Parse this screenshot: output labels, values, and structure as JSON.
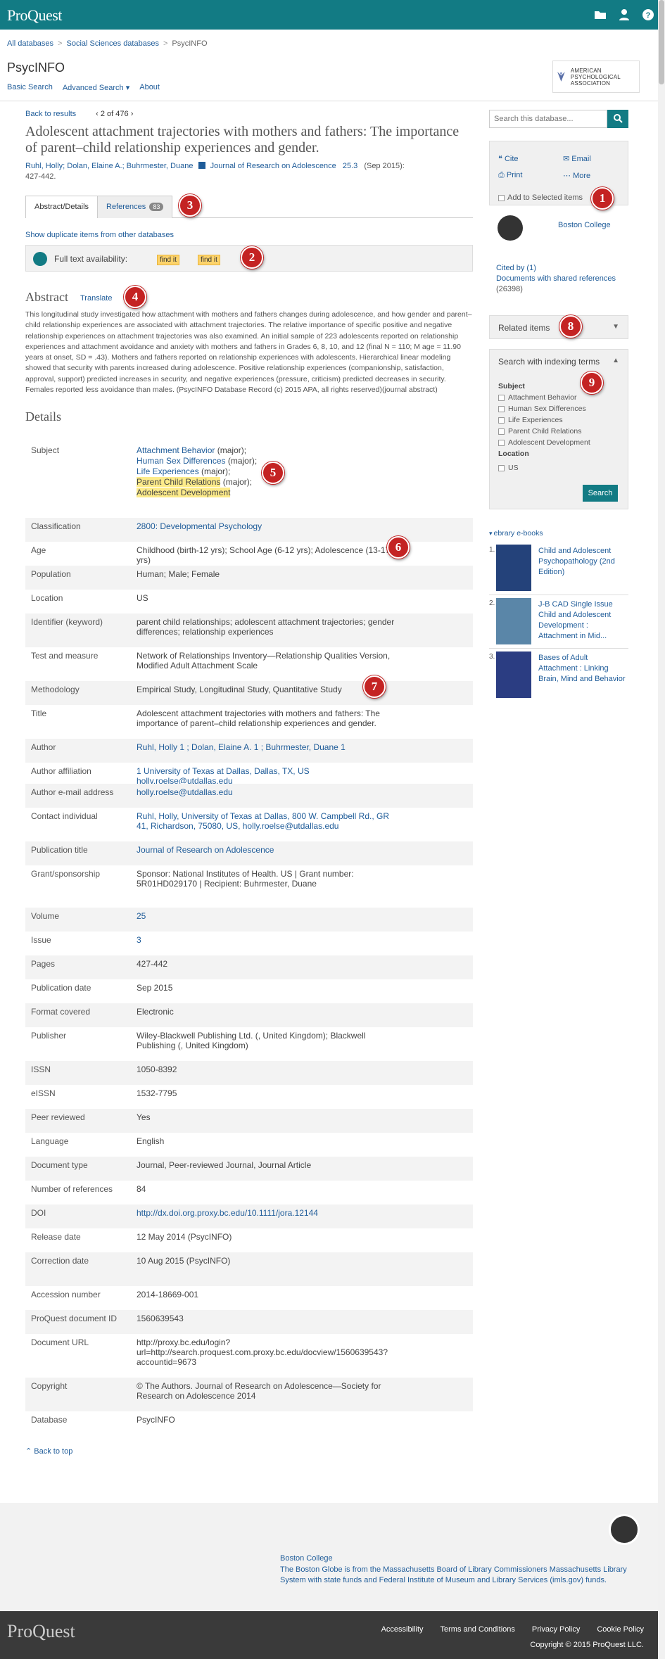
{
  "top": {
    "logo": "ProQuest"
  },
  "breadcrumb": [
    "All databases",
    "Social Sciences databases",
    "PsycINFO"
  ],
  "db": {
    "name": "PsycINFO",
    "nav": [
      "Basic Search",
      "Advanced Search ▾",
      "About"
    ],
    "publisher_logo": "AMERICAN PSYCHOLOGICAL ASSOCIATION"
  },
  "result": {
    "back": "Back to results",
    "pos": "2 of 476"
  },
  "doc": {
    "title": "Adolescent attachment trajectories with mothers and fathers: The importance of parent–child relationship experiences and gender.",
    "authors": "Ruhl, Holly; Dolan, Elaine A.; Buhrmester, Duane",
    "journal": "Journal of Research on Adolescence",
    "volume": "25.3",
    "citation": "(Sep 2015): 427-442."
  },
  "tabs": {
    "abstract": "Abstract/Details",
    "references": "References",
    "ref_count": "83"
  },
  "dup": "Show duplicate items from other databases",
  "fulltext": {
    "label": "Full text availability:",
    "find1": "find it",
    "find2": "find it"
  },
  "abstract": {
    "heading": "Abstract",
    "translate": "Translate",
    "text": "This longitudinal study investigated how attachment with mothers and fathers changes during adolescence, and how gender and parent–child relationship experiences are associated with attachment trajectories. The relative importance of specific positive and negative relationship experiences on attachment trajectories was also examined. An initial sample of 223 adolescents reported on relationship experiences and attachment avoidance and anxiety with mothers and fathers in Grades 6, 8, 10, and 12 (final N = 110; M age = 11.90 years at onset, SD = .43). Mothers and fathers reported on relationship experiences with adolescents. Hierarchical linear modeling showed that security with parents increased during adolescence. Positive relationship experiences (companionship, satisfaction, approval, support) predicted increases in security, and negative experiences (pressure, criticism) predicted decreases in security. Females reported less avoidance than males. (PsycINFO Database Record (c) 2015 APA, all rights reserved)(journal abstract)"
  },
  "details": {
    "heading": "Details",
    "subject": {
      "label": "Subject",
      "items": [
        {
          "term": "Attachment Behavior",
          "suffix": " (major);"
        },
        {
          "term": "Human Sex Differences",
          "suffix": " (major);"
        },
        {
          "term": "Life Experiences",
          "suffix": " (major);"
        },
        {
          "term": "Parent Child Relations",
          "suffix": " (major);"
        },
        {
          "term": "Adolescent Development",
          "suffix": ""
        }
      ]
    },
    "rows": [
      {
        "k": "Classification",
        "v": "2800: Developmental Psychology"
      },
      {
        "k": "Age",
        "v": "Childhood (birth-12 yrs); School Age (6-12 yrs); Adolescence (13-17 yrs)"
      },
      {
        "k": "Population",
        "v": "Human; Male; Female"
      },
      {
        "k": "Location",
        "v": "US"
      },
      {
        "k": "Identifier (keyword)",
        "v": "parent child relationships; adolescent attachment trajectories; gender differences; relationship experiences"
      },
      {
        "k": "Test and measure",
        "v": "Network of Relationships Inventory—Relationship Qualities Version, Modified Adult Attachment Scale"
      },
      {
        "k": "Methodology",
        "v": "Empirical Study, Longitudinal Study, Quantitative Study"
      },
      {
        "k": "Title",
        "v": "Adolescent attachment trajectories with mothers and fathers: The importance of parent–child relationship experiences and gender."
      },
      {
        "k": "Author",
        "v": "Ruhl, Holly 1 ; Dolan, Elaine A. 1 ; Buhrmester, Duane 1"
      },
      {
        "k": "Author affiliation",
        "v": "1 University of Texas at Dallas, Dallas, TX, US holly.roelse@utdallas.edu"
      },
      {
        "k": "Author e-mail address",
        "v": "holly.roelse@utdallas.edu"
      },
      {
        "k": "Contact individual",
        "v": "Ruhl, Holly, University of Texas at Dallas, 800 W. Campbell Rd., GR 41, Richardson, 75080, US, holly.roelse@utdallas.edu"
      },
      {
        "k": "Publication title",
        "v": "Journal of Research on Adolescence"
      },
      {
        "k": "Grant/sponsorship",
        "v": "Sponsor: National Institutes of Health. US | Grant number: 5R01HD029170 | Recipient: Buhrmester, Duane"
      },
      {
        "k": "Volume",
        "v": "25"
      },
      {
        "k": "Issue",
        "v": "3"
      },
      {
        "k": "Pages",
        "v": "427-442"
      },
      {
        "k": "Publication date",
        "v": "Sep 2015"
      },
      {
        "k": "Format covered",
        "v": "Electronic"
      },
      {
        "k": "Publisher",
        "v": "Wiley-Blackwell Publishing Ltd. (, United Kingdom); Blackwell Publishing (, United Kingdom)"
      },
      {
        "k": "ISSN",
        "v": "1050-8392"
      },
      {
        "k": "eISSN",
        "v": "1532-7795"
      },
      {
        "k": "Peer reviewed",
        "v": "Yes"
      },
      {
        "k": "Language",
        "v": "English"
      },
      {
        "k": "Document type",
        "v": "Journal, Peer-reviewed Journal, Journal Article"
      },
      {
        "k": "Number of references",
        "v": "84"
      },
      {
        "k": "DOI",
        "v": "http://dx.doi.org.proxy.bc.edu/10.1111/jora.12144"
      },
      {
        "k": "Release date",
        "v": "12 May 2014 (PsycINFO)"
      },
      {
        "k": "Correction date",
        "v": "10 Aug 2015 (PsycINFO)"
      },
      {
        "k": "Accession number",
        "v": "2014-18669-001"
      },
      {
        "k": "ProQuest document ID",
        "v": "1560639543"
      },
      {
        "k": "Document URL",
        "v": "http://proxy.bc.edu/login?url=http://search.proquest.com.proxy.bc.edu/docview/1560639543?accountid=9673"
      },
      {
        "k": "Copyright",
        "v": "© The Authors. Journal of Research on Adolescence—Society for Research on Adolescence 2014"
      },
      {
        "k": "Database",
        "v": "PsycINFO"
      }
    ],
    "back_to_top": "Back to top"
  },
  "side": {
    "search_placeholder": "Search this database...",
    "cite": "Cite",
    "email": "Email",
    "print": "Print",
    "more": "More",
    "add_selected": "Add to Selected items",
    "library": "Boston College",
    "cited_by": "Cited by (1)",
    "shared_refs": "Documents with shared references",
    "shared_count": "(26398)",
    "related": "Related items",
    "indexing": "Search with indexing terms",
    "subject_h": "Subject",
    "subjects": [
      "Attachment Behavior",
      "Human Sex Differences",
      "Life Experiences",
      "Parent Child Relations",
      "Adolescent Development"
    ],
    "location_h": "Location",
    "locations": [
      "US"
    ],
    "search_btn": "Search",
    "ebooks_h": "ebrary e-books",
    "ebooks": [
      {
        "n": "1.",
        "t": "Child and Adolescent Psychopathology (2nd Edition)"
      },
      {
        "n": "2.",
        "t": "J-B CAD Single Issue Child and Adolescent Development : Attachment in Mid..."
      },
      {
        "n": "3.",
        "t": "Bases of Adult Attachment : Linking Brain, Mind and Behavior"
      }
    ]
  },
  "markers": [
    "1",
    "2",
    "3",
    "4",
    "5",
    "6",
    "7",
    "8",
    "9"
  ],
  "footer": {
    "lib": "Boston College",
    "text": "The Boston Globe is from the Massachusetts Board of Library Commissioners Massachusetts Library System with state funds and Federal Institute of Museum and Library Services (imls.gov) funds.",
    "logo": "ProQuest",
    "links": [
      "Accessibility",
      "Terms and Conditions",
      "Privacy Policy",
      "Cookie Policy"
    ],
    "copyright": "Copyright © 2015 ProQuest LLC."
  },
  "colors": {
    "brand": "#127b84",
    "link": "#1f5c99",
    "marker": "#c42323",
    "highlight": "#fdeb8a"
  }
}
